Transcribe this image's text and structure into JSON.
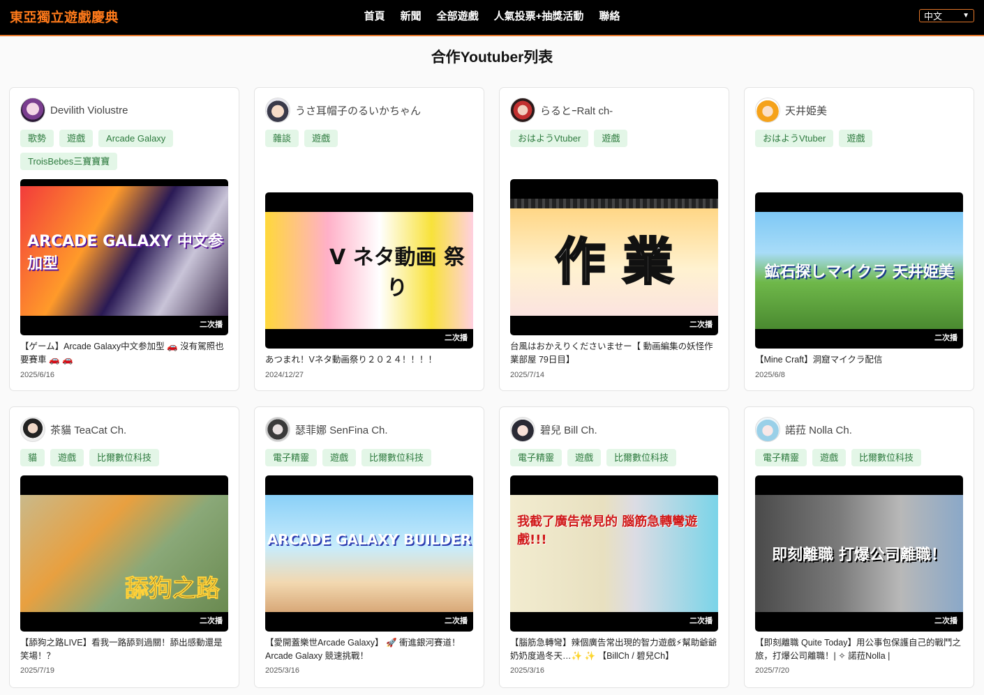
{
  "header": {
    "brand": "東亞獨立遊戲慶典",
    "nav": [
      "首頁",
      "新聞",
      "全部遊戲",
      "人氣投票+抽獎活動",
      "聯絡"
    ],
    "language": "中文"
  },
  "page_title": "合作Youtuber列表",
  "badge_label": "二次播",
  "cards": [
    {
      "name": "Devilith Violustre",
      "tags": [
        "歌勢",
        "遊戲",
        "Arcade Galaxy",
        "TroisBebes三寶寶寶"
      ],
      "title": "【ゲーム】Arcade Galaxy中文参加型 🚗 沒有駕照也要賽車 🚗 🚗",
      "date": "2025/6/16",
      "thumb_text": "ARCADE GALAXY 中文参加型"
    },
    {
      "name": "うさ耳帽子のるいかちゃん",
      "tags": [
        "雜談",
        "遊戲"
      ],
      "title": "あつまれ！Vネタ動画祭り２０２４！！！！",
      "date": "2024/12/27",
      "thumb_text": "V ネタ動画 祭り"
    },
    {
      "name": "らるとｰRalt ch-",
      "tags": [
        "おはようVtuber",
        "遊戲"
      ],
      "title": "台風はおかえりくださいませー【 動画編集の妖怪作業部屋 79日目】",
      "date": "2025/7/14",
      "thumb_text": "作 業"
    },
    {
      "name": "天井姫美",
      "tags": [
        "おはようVtuber",
        "遊戲"
      ],
      "title": "【Mine Craft】洞窟マイクラ配信",
      "date": "2025/6/8",
      "thumb_text": "鉱石探しマイクラ 天井姫美"
    },
    {
      "name": "茶貓 TeaCat Ch.",
      "tags": [
        "貓",
        "遊戲",
        "比爾數位科技"
      ],
      "title": "【舔狗之路LIVE】看我一路舔到過關！舔出感動還是笑場！？",
      "date": "2025/7/19",
      "thumb_text": "舔狗之路"
    },
    {
      "name": "瑟菲娜 SenFina Ch.",
      "tags": [
        "電子精靈",
        "遊戲",
        "比爾數位科技"
      ],
      "title": "【愛開蓋樂世Arcade Galaxy】 🚀 衝進銀河賽道！Arcade Galaxy 競速挑戰！",
      "date": "2025/3/16",
      "thumb_text": "ARCADE GALAXY BUILDER"
    },
    {
      "name": "碧兒 Bill Ch.",
      "tags": [
        "電子精靈",
        "遊戲",
        "比爾數位科技"
      ],
      "title": "【腦筋急轉彎】辣個廣告常出現的智力遊戲⚡幫助爺爺奶奶度過冬天…✨ ✨ 【BillCh / 碧兒Ch】",
      "date": "2025/3/16",
      "thumb_text": "我截了廣告常見的 腦筋急轉彎遊戲!!!"
    },
    {
      "name": "諾菈 Nolla Ch.",
      "tags": [
        "電子精靈",
        "遊戲",
        "比爾數位科技"
      ],
      "title": "【即刻離職 Quite Today】用公事包保護自己的戰鬥之旅，打爆公司離職！| ✧ 諾菈Nolla |",
      "date": "2025/7/20",
      "thumb_text": "即刻離職 打爆公司離職！"
    }
  ],
  "colors": {
    "accent": "#ff7a1a",
    "tag_bg": "#e3f6e7",
    "tag_text": "#2d7a3e"
  }
}
